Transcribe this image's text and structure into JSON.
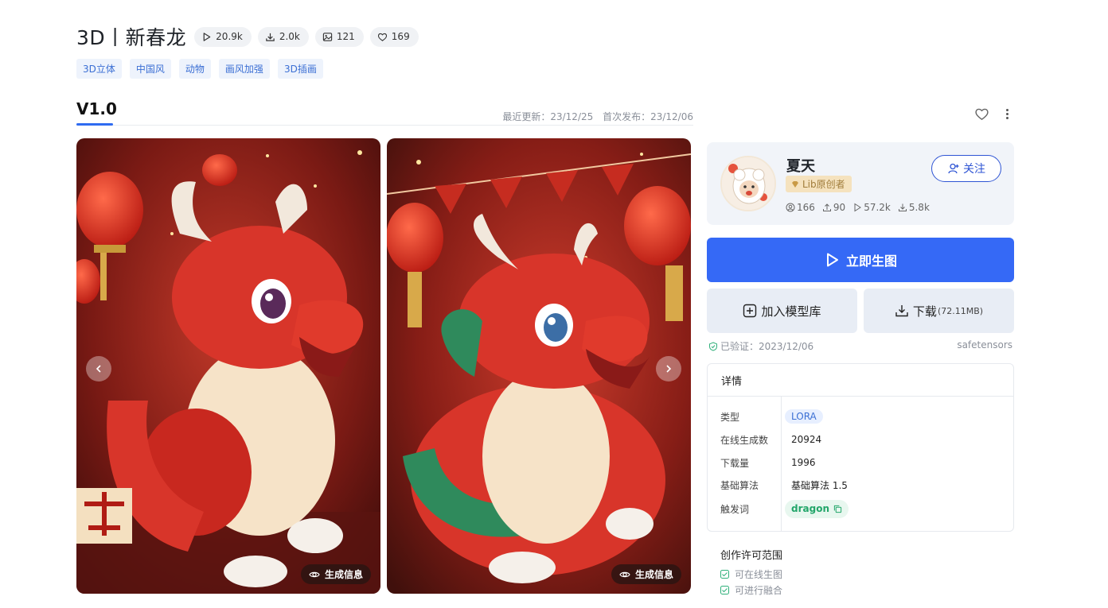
{
  "model": {
    "title": "3D丨新春龙",
    "stats": {
      "runs": "20.9k",
      "downloads": "2.0k",
      "images": "121",
      "likes": "169"
    },
    "tags": [
      "3D立体",
      "中国风",
      "动物",
      "画风加强",
      "3D插画"
    ]
  },
  "version": {
    "name": "V1.0",
    "updated": "最近更新：23/12/25",
    "published": "首次发布：23/12/06"
  },
  "gallery": {
    "gen_info_label": "生成信息"
  },
  "creator": {
    "name": "夏天",
    "badge": "Lib原创者",
    "followers": "166",
    "uploads": "90",
    "runs": "57.2k",
    "downloads": "5.8k",
    "follow_label": "关注"
  },
  "actions": {
    "generate_label": "立即生图",
    "add_to_library_label": "加入模型库",
    "download_label": "下载",
    "download_size": "(72.11MB)"
  },
  "verification": {
    "verified_text": "已验证：2023/12/06",
    "format": "safetensors"
  },
  "details": {
    "heading": "详情",
    "rows": [
      {
        "key": "类型",
        "value": "LORA"
      },
      {
        "key": "在线生成数",
        "value": "20924"
      },
      {
        "key": "下载量",
        "value": "1996"
      },
      {
        "key": "基础算法",
        "value": "基础算法 1.5"
      },
      {
        "key": "触发词",
        "value": "dragon"
      }
    ]
  },
  "license": {
    "title": "创作许可范围",
    "items": [
      "可在线生图",
      "可进行融合"
    ]
  },
  "colors": {
    "accent": "#3569f6",
    "tag_bg": "#eef3fc",
    "tag_text": "#3b6fd4",
    "trigger_green": "#23a66a",
    "badge_gold": "#f5e2be"
  }
}
